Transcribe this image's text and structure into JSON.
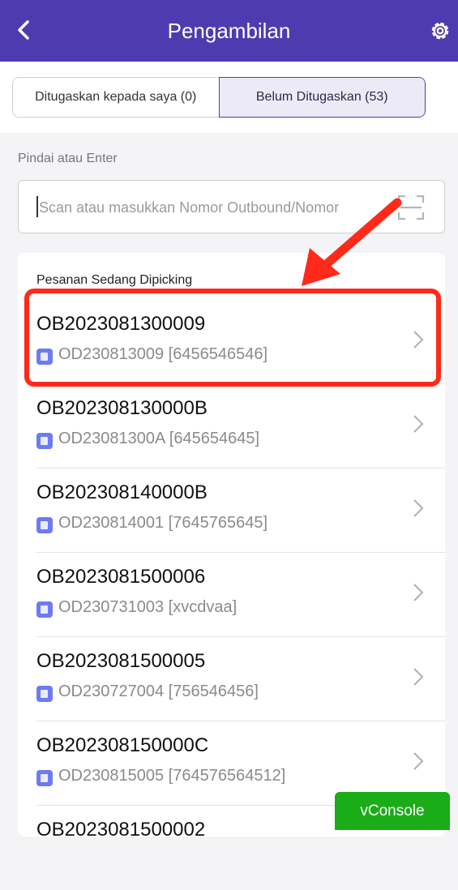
{
  "header": {
    "title": "Pengambilan"
  },
  "tabs": [
    {
      "label": "Ditugaskan kepada saya (0)"
    },
    {
      "label": "Belum Ditugaskan (53)"
    }
  ],
  "scan": {
    "label": "Pindai atau Enter",
    "placeholder": "Scan atau masukkan Nomor Outbound/Nomor"
  },
  "list": {
    "section_title": "Pesanan Sedang Dipicking",
    "items": [
      {
        "ob": "OB2023081300009",
        "od": "OD230813009 [6456546546]"
      },
      {
        "ob": "OB202308130000B",
        "od": "OD23081300A [645654645]"
      },
      {
        "ob": "OB202308140000B",
        "od": "OD230814001 [7645765645]"
      },
      {
        "ob": "OB2023081500006",
        "od": "OD230731003 [xvcdvaa]"
      },
      {
        "ob": "OB2023081500005",
        "od": "OD230727004 [756546456]"
      },
      {
        "ob": "OB202308150000C",
        "od": "OD230815005 [764576564512]"
      },
      {
        "ob": "OB2023081500002",
        "od": ""
      }
    ]
  },
  "vconsole": {
    "label": "vConsole"
  },
  "colors": {
    "header": "#4f3bb0",
    "highlight": "#ff2a1a",
    "vconsole": "#1aad19"
  }
}
